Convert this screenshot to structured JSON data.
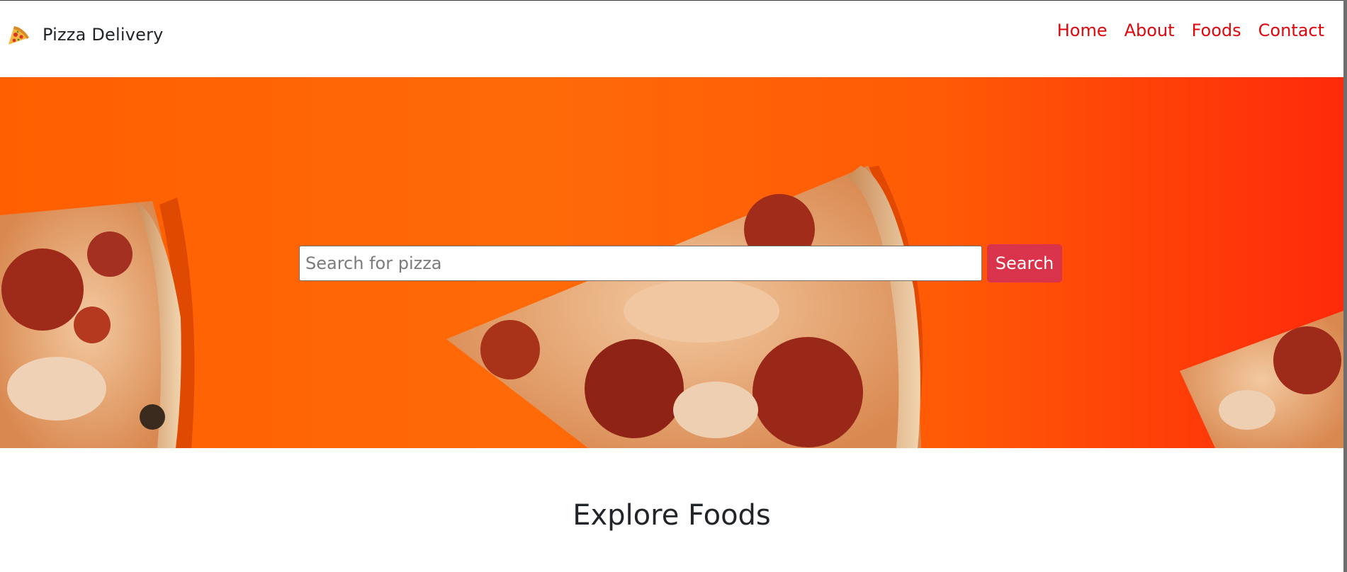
{
  "navbar": {
    "brand_name": "Pizza Delivery",
    "logo_icon": "pizza-slice-icon",
    "links": [
      {
        "label": "Home"
      },
      {
        "label": "About"
      },
      {
        "label": "Foods"
      },
      {
        "label": "Contact"
      }
    ],
    "link_color": "#e0070c"
  },
  "hero": {
    "background": "pizza-slices-on-orange-background",
    "search": {
      "placeholder": "Search for pizza",
      "value": "",
      "button_label": "Search",
      "button_color": "#d9344b"
    }
  },
  "sections": {
    "explore_title": "Explore Foods"
  },
  "colors": {
    "hero_orange": "#ff6a08",
    "text_dark": "#212529"
  }
}
